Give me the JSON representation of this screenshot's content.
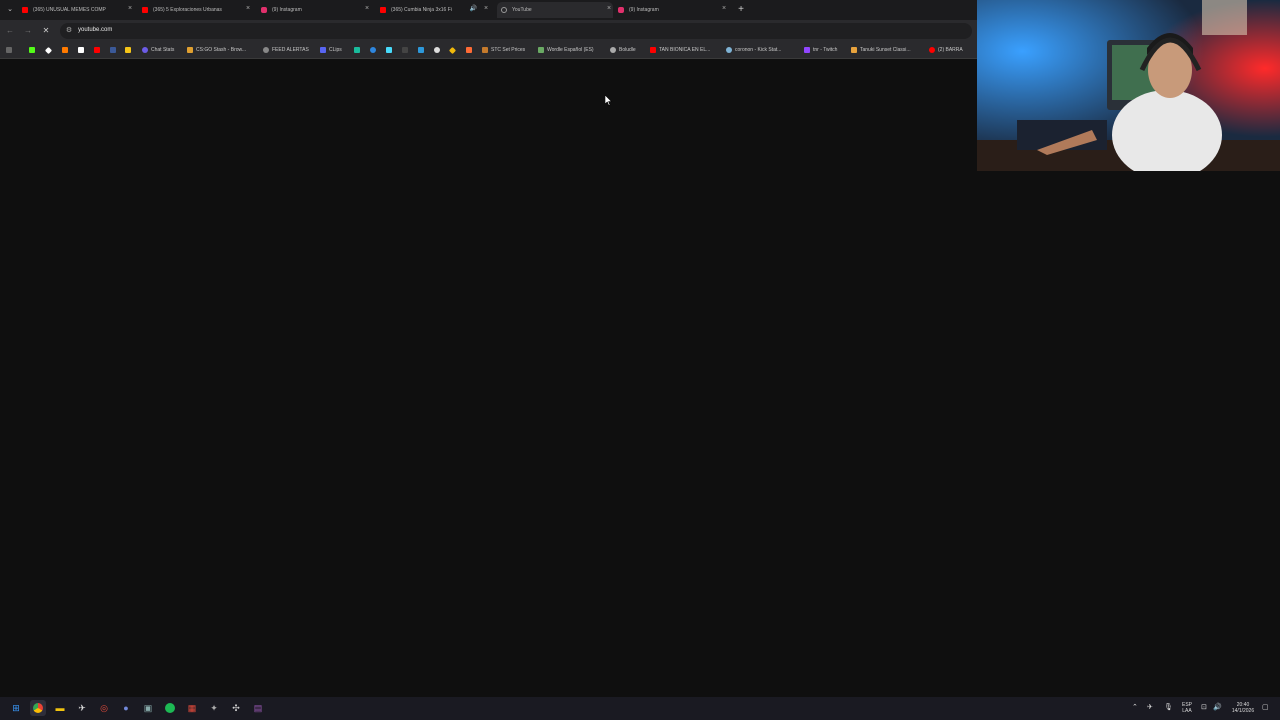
{
  "browser": {
    "tabs": [
      {
        "title": "(365) UNUSUAL MEMES COMP",
        "favicon": "youtube-icon",
        "color": "#ff0000"
      },
      {
        "title": "(365) 5 Exploraciones Urbanas",
        "favicon": "youtube-icon",
        "color": "#ff0000"
      },
      {
        "title": "(9) Instagram",
        "favicon": "instagram-icon",
        "color": "#e1306c"
      },
      {
        "title": "(365) Cumbia Ninja 3x16 Fi",
        "favicon": "youtube-icon",
        "color": "#ff0000"
      },
      {
        "title": "YouTube",
        "favicon": "loading-icon",
        "color": "#888888",
        "active": true
      },
      {
        "title": "(9) Instagram",
        "favicon": "instagram-icon",
        "color": "#e1306c"
      }
    ],
    "new_tab_label": "+",
    "address": "youtube.com",
    "bookmarks": [
      {
        "label": "Chat Stats"
      },
      {
        "label": "CS:GO Stash - Brow..."
      },
      {
        "label": "FEED ALERTAS"
      },
      {
        "label": "CLips"
      },
      {
        "label": "STC Set Prices"
      },
      {
        "label": "Wordle Español (ES)"
      },
      {
        "label": "Boludle"
      },
      {
        "label": "TAN BIONICA EN EL..."
      },
      {
        "label": "coronon - Kick Stat..."
      },
      {
        "label": "tnr - Twitch"
      },
      {
        "label": "Tanuki Sunset Classi..."
      },
      {
        "label": "(2) BARRA"
      }
    ]
  },
  "taskbar": {
    "language": "ESP",
    "layout": "LAA",
    "time": "20:40",
    "date": "14/1/2026"
  },
  "colors": {
    "page_bg": "#0f0f0f",
    "chrome_bg": "#2a2a2d",
    "taskbar_bg": "#1a1a22"
  }
}
